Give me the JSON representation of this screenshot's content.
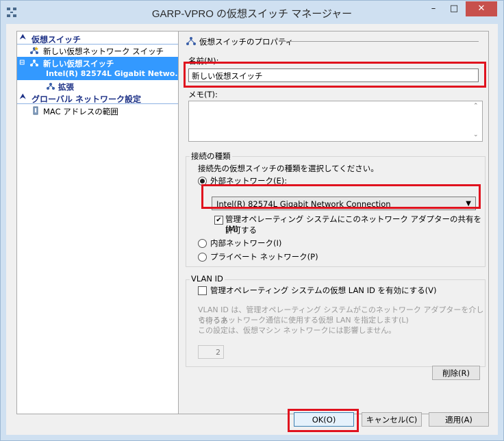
{
  "window": {
    "title": "GARP-VPRO の仮想スイッチ マネージャー",
    "minimize_label": "–",
    "maximize_label": "□",
    "close_label": "✕"
  },
  "tree": {
    "section_switches": "仮想スイッチ",
    "new_switch_item": "新しい仮想ネットワーク スイッチ",
    "selected_switch_name": "新しい仮想スイッチ",
    "selected_switch_adapter": "Intel(R) 82574L Gigabit Netwo...",
    "extensions_item": "拡張",
    "section_global": "グローバル ネットワーク設定",
    "mac_range_item": "MAC アドレスの範囲"
  },
  "properties": {
    "header": "仮想スイッチのプロパティ",
    "name_label": "名前(N):",
    "name_value": "新しい仮想スイッチ",
    "memo_label": "メモ(T):",
    "memo_value": ""
  },
  "connection": {
    "group_title": "接続の種類",
    "description": "接続先の仮想スイッチの種類を選択してください。",
    "external_label": "外部ネットワーク(E):",
    "external_selected": true,
    "adapter_value": "Intel(R) 82574L Gigabit Network Connection",
    "share_label_line1": "管理オペレーティング システムにこのネットワーク アダプターの共有を許可する",
    "share_label_line2": "(M)",
    "share_checked": true,
    "internal_label": "内部ネットワーク(I)",
    "private_label": "プライベート ネットワーク(P)"
  },
  "vlan": {
    "group_title": "VLAN ID",
    "enable_label": "管理オペレーティング システムの仮想 LAN ID を有効にする(V)",
    "enable_checked": false,
    "description_line1": "VLAN ID は、管理オペレーティング システムがこのネットワーク アダプターを介して行うあ",
    "description_line2": "らゆるネットワーク通信に使用する仮想 LAN を指定します(L)",
    "description_line3": "この設定は、仮想マシン ネットワークには影響しません。",
    "vlan_value": "2"
  },
  "buttons": {
    "remove": "削除(R)",
    "ok": "OK(O)",
    "cancel": "キャンセル(C)",
    "apply": "適用(A)"
  },
  "colors": {
    "title_bg": "#cfe0f1",
    "selection": "#3399ff",
    "tree_header": "#1e3287",
    "highlight_box": "#e0121e",
    "close_button": "#c7504c"
  }
}
